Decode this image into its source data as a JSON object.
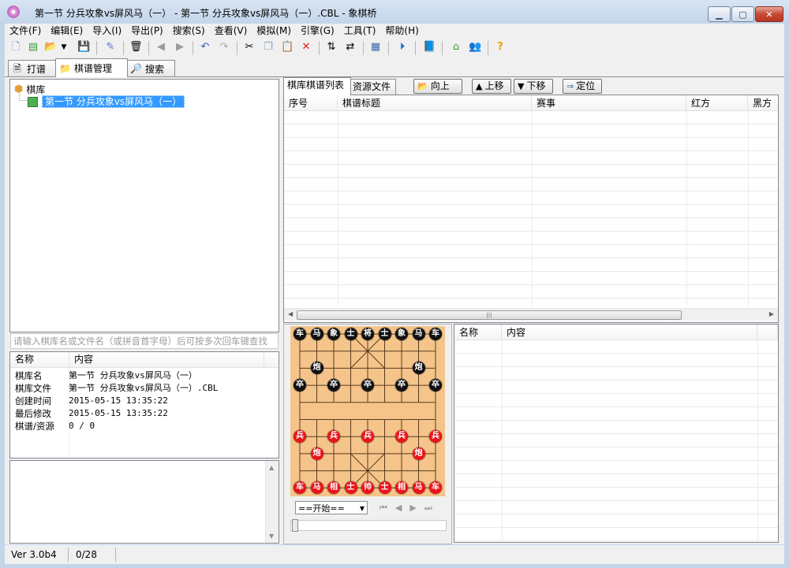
{
  "window": {
    "title": "第一节  分兵攻象vs屏风马（一） - 第一节  分兵攻象vs屏风马（一）.CBL - 象棋桥"
  },
  "menu": [
    "文件(F)",
    "编辑(E)",
    "导入(I)",
    "导出(P)",
    "搜索(S)",
    "查看(V)",
    "模拟(M)",
    "引擎(G)",
    "工具(T)",
    "帮助(H)"
  ],
  "main_tabs": [
    {
      "label": "打谱",
      "icon": "document-icon"
    },
    {
      "label": "棋谱管理",
      "icon": "folder-icon"
    },
    {
      "label": "搜索",
      "icon": "magnifier-icon"
    }
  ],
  "tree": {
    "root": "棋库",
    "child": "第一节  分兵攻象vs屏风马（一）"
  },
  "search_hint": "请输入棋库名或文件名（或拼音首字母）后可按多次回车键查找",
  "info_table": {
    "headers": [
      "名称",
      "内容"
    ],
    "rows": [
      {
        "k": "棋库名",
        "v": "第一节  分兵攻象vs屏风马（一）"
      },
      {
        "k": "棋库文件",
        "v": "第一节  分兵攻象vs屏风马（一）.CBL"
      },
      {
        "k": "创建时间",
        "v": "2015-05-15 13:35:22"
      },
      {
        "k": "最后修改",
        "v": "2015-05-15 13:35:22"
      },
      {
        "k": "棋谱/资源",
        "v": "0 / 0"
      }
    ]
  },
  "right_tabs": [
    "棋库棋谱列表",
    "资源文件"
  ],
  "right_buttons": {
    "up": "向上",
    "move_up": "上移",
    "move_down": "下移",
    "locate": "定位"
  },
  "list_columns": [
    "序号",
    "棋谱标题",
    "赛事",
    "红方",
    "黑方"
  ],
  "props_columns": [
    "名称",
    "内容"
  ],
  "move_select": "==开始==",
  "board": {
    "black_back": [
      "车",
      "马",
      "象",
      "士",
      "将",
      "士",
      "象",
      "马",
      "车"
    ],
    "black_cannon": "炮",
    "black_pawn": "卒",
    "red_back": [
      "车",
      "马",
      "相",
      "士",
      "帅",
      "士",
      "相",
      "马",
      "车"
    ],
    "red_cannon": "炮",
    "red_pawn": "兵"
  },
  "status": {
    "version": "Ver 3.0b4",
    "count": "0/28"
  }
}
